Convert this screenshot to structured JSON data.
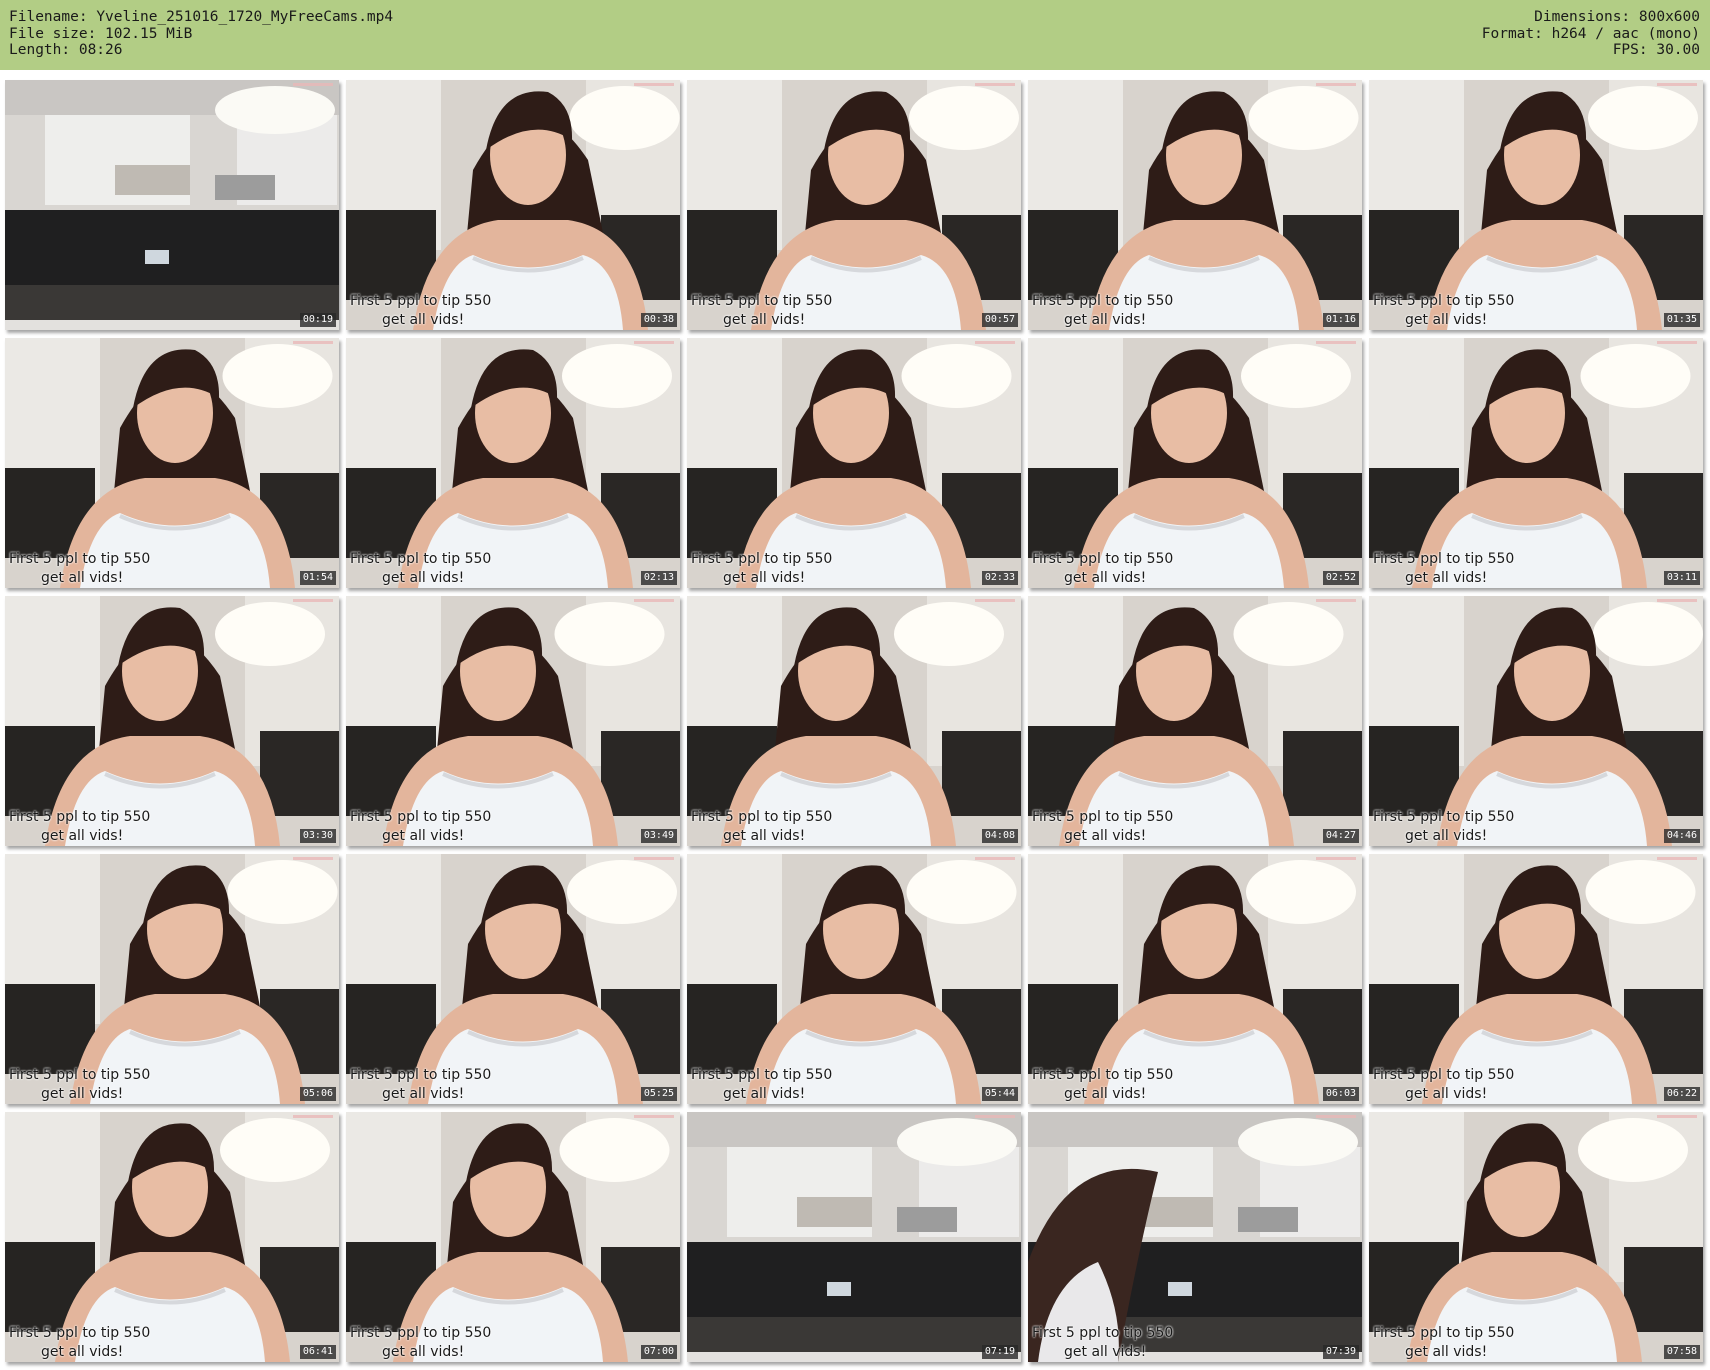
{
  "header": {
    "filename_label": "Filename:",
    "filename": "Yveline_251016_1720_MyFreeCams.mp4",
    "filesize_label": "File size:",
    "filesize": "102.15 MiB",
    "length_label": "Length:",
    "length": "08:26",
    "dimensions_label": "Dimensions:",
    "dimensions": "800x600",
    "format_label": "Format:",
    "format": "h264 / aac (mono)",
    "fps_label": "FPS:",
    "fps": "30.00"
  },
  "overlay": {
    "line1": "First 5 ppl to tip 550",
    "line2": "get all vids!"
  },
  "colors": {
    "header_bg": "#b2cd85",
    "timestamp_bg": "#282828"
  },
  "thumbnails": [
    {
      "time": "00:19",
      "scene": "kitchen"
    },
    {
      "time": "00:38",
      "scene": "person"
    },
    {
      "time": "00:57",
      "scene": "person"
    },
    {
      "time": "01:16",
      "scene": "person"
    },
    {
      "time": "01:35",
      "scene": "person"
    },
    {
      "time": "01:54",
      "scene": "person"
    },
    {
      "time": "02:13",
      "scene": "person"
    },
    {
      "time": "02:33",
      "scene": "person"
    },
    {
      "time": "02:52",
      "scene": "person"
    },
    {
      "time": "03:11",
      "scene": "person"
    },
    {
      "time": "03:30",
      "scene": "person"
    },
    {
      "time": "03:49",
      "scene": "person"
    },
    {
      "time": "04:08",
      "scene": "person"
    },
    {
      "time": "04:27",
      "scene": "person"
    },
    {
      "time": "04:46",
      "scene": "person"
    },
    {
      "time": "05:06",
      "scene": "person"
    },
    {
      "time": "05:25",
      "scene": "person"
    },
    {
      "time": "05:44",
      "scene": "person"
    },
    {
      "time": "06:03",
      "scene": "person"
    },
    {
      "time": "06:22",
      "scene": "person"
    },
    {
      "time": "06:41",
      "scene": "person"
    },
    {
      "time": "07:00",
      "scene": "person"
    },
    {
      "time": "07:19",
      "scene": "kitchen"
    },
    {
      "time": "07:39",
      "scene": "kitchen-person"
    },
    {
      "time": "07:58",
      "scene": "person"
    }
  ]
}
